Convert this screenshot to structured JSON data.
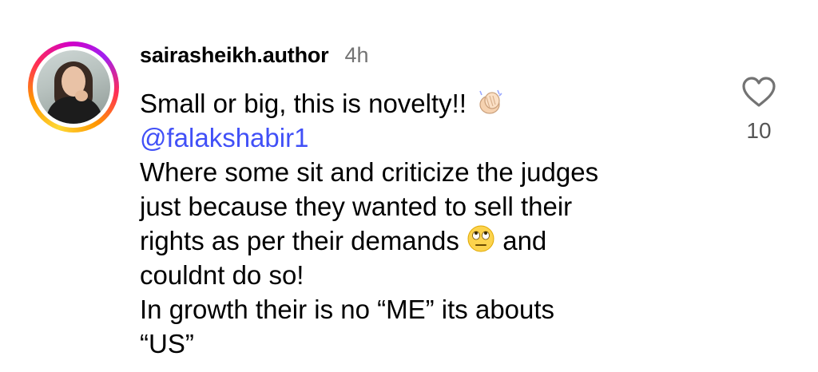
{
  "comment": {
    "username": "sairasheikh.author",
    "timestamp": "4h",
    "text_line1": "Small or big, this is novelty!!",
    "emoji1": "clapping-hands",
    "mention": "@falakshabir1",
    "text_line3": "Where some sit and criticize the judges",
    "text_line4": "just because they wanted to sell their",
    "text_line5a": "rights as per their demands",
    "emoji2": "face-with-rolling-eyes",
    "text_line5b": "and",
    "text_line6": "couldnt do so!",
    "text_line7": "In growth their is no “ME” its abouts",
    "text_line8": "“US”",
    "like_count": "10"
  },
  "colors": {
    "mention": "#4150f7",
    "timestamp": "#737373",
    "like_icon": "#737373"
  }
}
